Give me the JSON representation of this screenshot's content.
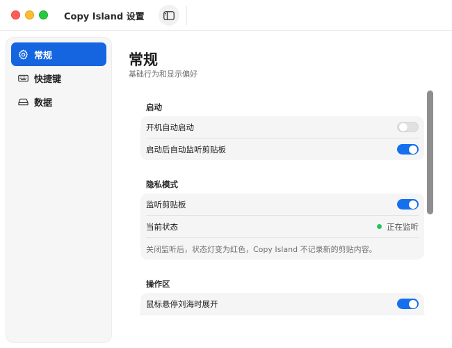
{
  "window": {
    "title": "Copy Island 设置",
    "sidebar_toggle_icon": "sidebar-icon"
  },
  "sidebar": {
    "items": [
      {
        "label": "常规",
        "icon": "gear-icon",
        "active": true
      },
      {
        "label": "快捷键",
        "icon": "keyboard-icon",
        "active": false
      },
      {
        "label": "数据",
        "icon": "drive-icon",
        "active": false
      }
    ]
  },
  "main": {
    "title": "常规",
    "subtitle": "基础行为和显示偏好",
    "sections": [
      {
        "title": "启动",
        "rows": [
          {
            "label": "开机自动启动",
            "toggle": false
          },
          {
            "label": "启动后自动监听剪贴板",
            "toggle": true
          }
        ]
      },
      {
        "title": "隐私模式",
        "rows": [
          {
            "label": "监听剪贴板",
            "toggle": true
          },
          {
            "label": "当前状态",
            "status": "正在监听"
          }
        ],
        "note": "关闭监听后，状态灯变为红色，Copy Island 不记录新的剪贴内容。"
      },
      {
        "title": "操作区",
        "rows": [
          {
            "label": "鼠标悬停刘海时展开",
            "toggle": true
          }
        ]
      }
    ]
  },
  "colors": {
    "accent": "#1565e0",
    "toggle_on": "#1570ef",
    "status_green": "#22c55e"
  }
}
